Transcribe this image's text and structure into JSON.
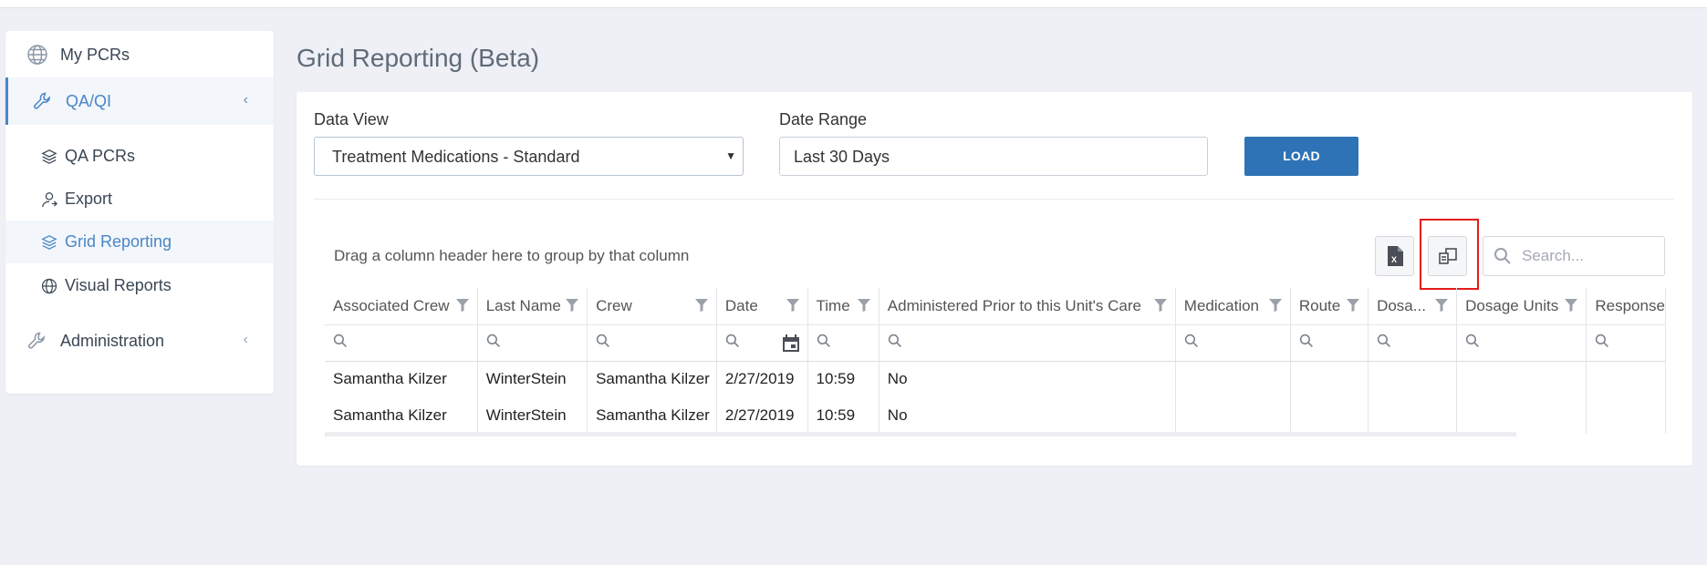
{
  "sidebar": {
    "items": [
      {
        "label": "My PCRs",
        "icon": "globe-icon"
      },
      {
        "label": "QA/QI",
        "icon": "wrench-icon",
        "expanded": true
      },
      {
        "label": "QA PCRs",
        "icon": "layers-icon"
      },
      {
        "label": "Export",
        "icon": "user-export-icon"
      },
      {
        "label": "Grid Reporting",
        "icon": "layers-icon",
        "active": true
      },
      {
        "label": "Visual Reports",
        "icon": "globe-icon"
      },
      {
        "label": "Administration",
        "icon": "wrench-icon"
      }
    ],
    "chevron": "‹"
  },
  "page": {
    "title": "Grid Reporting (Beta)"
  },
  "filters": {
    "data_view_label": "Data View",
    "data_view_value": "Treatment Medications - Standard",
    "date_range_label": "Date Range",
    "date_range_value": "Last 30 Days",
    "load_label": "LOAD"
  },
  "grid": {
    "group_hint": "Drag a column header here to group by that column",
    "search_placeholder": "Search...",
    "columns": [
      "Associated Crew",
      "Last Name",
      "Crew",
      "Date",
      "Time",
      "Administered Prior to this Unit's Care",
      "Medication",
      "Route",
      "Dosa...",
      "Dosage Units",
      "Response"
    ],
    "rows": [
      [
        "Samantha Kilzer",
        "WinterStein",
        "Samantha Kilzer",
        "2/27/2019",
        "10:59",
        "No",
        "",
        "",
        "",
        "",
        ""
      ],
      [
        "Samantha Kilzer",
        "WinterStein",
        "Samantha Kilzer",
        "2/27/2019",
        "10:59",
        "No",
        "",
        "",
        "",
        "",
        ""
      ]
    ]
  },
  "colors": {
    "accent": "#4a86c5",
    "button": "#2e73b5",
    "highlight": "#e21b1b",
    "background": "#eef0f5"
  }
}
